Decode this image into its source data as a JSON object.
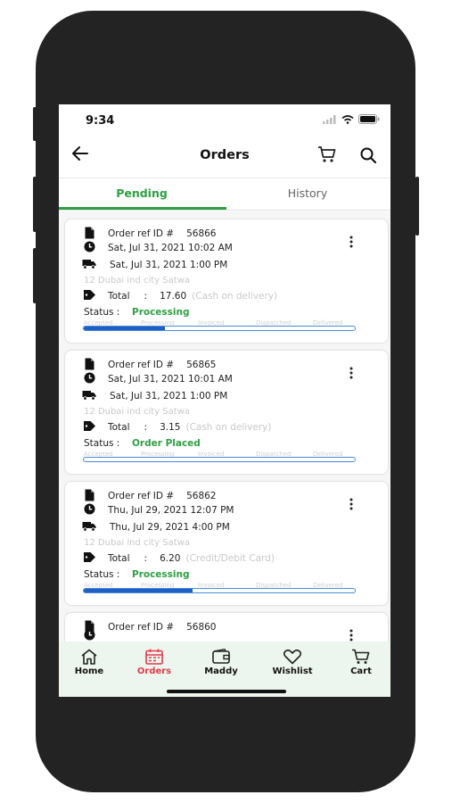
{
  "status_bar": {
    "time": "9:34"
  },
  "header": {
    "title": "Orders"
  },
  "tabs": [
    {
      "label": "Pending"
    },
    {
      "label": "History"
    }
  ],
  "stage_labels": [
    "Accepted",
    "Processing",
    "Invoiced",
    "Dispatched",
    "Delivered"
  ],
  "orders": [
    {
      "ref_label": "Order ref ID #",
      "ref_id": "56866",
      "placed": "Sat, Jul 31, 2021 10:02 AM",
      "delivery": "Sat, Jul 31, 2021 1:00 PM",
      "address": "12 Dubai ind city Satwa",
      "total_label": "Total",
      "total_sep": ":",
      "total": "17.60",
      "payment": "(Cash on delivery)",
      "status_label": "Status :",
      "status": "Processing",
      "progress_fraction": 0.3
    },
    {
      "ref_label": "Order ref ID #",
      "ref_id": "56865",
      "placed": "Sat, Jul 31, 2021 10:01 AM",
      "delivery": "Sat, Jul 31, 2021 1:00 PM",
      "address": "12 Dubai ind city Satwa",
      "total_label": "Total",
      "total_sep": ":",
      "total": "3.15",
      "payment": "(Cash on delivery)",
      "status_label": "Status :",
      "status": "Order Placed",
      "progress_fraction": 0.0
    },
    {
      "ref_label": "Order ref ID #",
      "ref_id": "56862",
      "placed": "Thu, Jul 29, 2021 12:07 PM",
      "delivery": "Thu, Jul 29, 2021 4:00 PM",
      "address": "12 Dubai ind city Satwa",
      "total_label": "Total",
      "total_sep": ":",
      "total": "6.20",
      "payment": "(Credit/Debit Card)",
      "status_label": "Status :",
      "status": "Processing",
      "progress_fraction": 0.4
    },
    {
      "ref_label": "Order ref ID #",
      "ref_id": "56860"
    }
  ],
  "bottom_nav": [
    {
      "label": "Home",
      "icon": "home-icon"
    },
    {
      "label": "Orders",
      "icon": "calendar-icon",
      "active": true
    },
    {
      "label": "Maddy",
      "icon": "wallet-icon"
    },
    {
      "label": "Wishlist",
      "icon": "heart-icon"
    },
    {
      "label": "Cart",
      "icon": "cart-icon"
    }
  ],
  "colors": {
    "accent": "#2ea043",
    "active_nav": "#e03a4b",
    "progress": "#1e5fc4"
  }
}
